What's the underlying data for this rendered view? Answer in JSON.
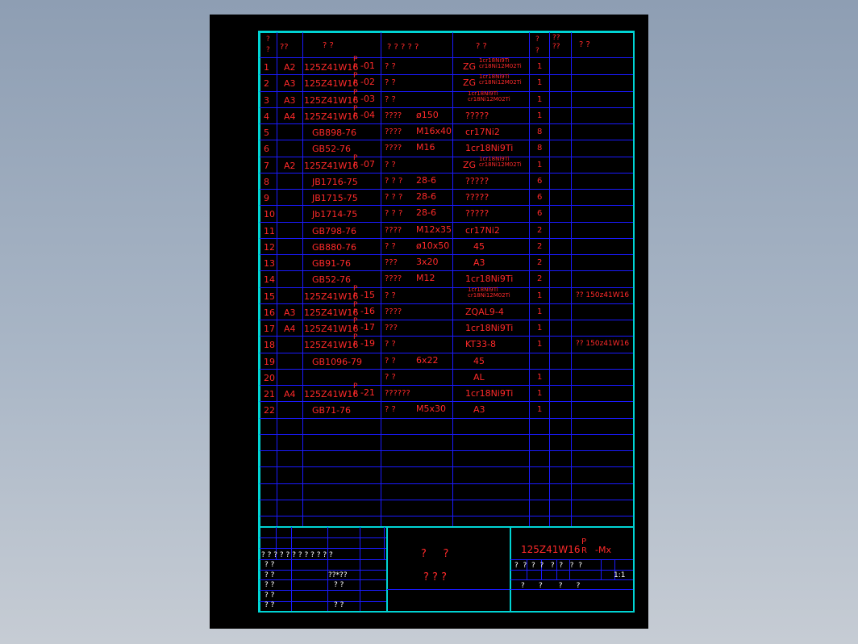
{
  "header": {
    "seq": "? ?",
    "zone": "??",
    "code": "? ?",
    "name": "? ? ? ? ?",
    "material": "? ?",
    "qty": "? ?",
    "weight": "?? ??",
    "remark": "? ?"
  },
  "rows": [
    {
      "n": "1",
      "zone": "A2",
      "code": "125Z41W16",
      "suf": "-01",
      "name": "? ?",
      "spec": "",
      "mat": "ZG",
      "matsub": "1cr18Ni9Ti|cr18Ni12M02Ti",
      "qty": "1",
      "remark": ""
    },
    {
      "n": "2",
      "zone": "A3",
      "code": "125Z41W16",
      "suf": "-02",
      "name": "? ?",
      "spec": "",
      "mat": "ZG",
      "matsub": "1cr18Ni9Ti|cr18Ni12M02Ti",
      "qty": "1",
      "remark": ""
    },
    {
      "n": "3",
      "zone": "A3",
      "code": "125Z41W16",
      "suf": "-03",
      "name": "? ?",
      "spec": "",
      "mat": "",
      "matsub": "1cr18Ni9Ti|cr18Ni12M02Ti",
      "qty": "1",
      "remark": ""
    },
    {
      "n": "4",
      "zone": "A4",
      "code": "125Z41W16",
      "suf": "-04",
      "name": "????",
      "spec": "ø150",
      "mat": "?????",
      "matsub": "",
      "qty": "1",
      "remark": ""
    },
    {
      "n": "5",
      "zone": "",
      "code": "GB898-76",
      "suf": "",
      "name": "????",
      "spec": "M16x40",
      "mat": "cr17Ni2",
      "matsub": "",
      "qty": "8",
      "remark": ""
    },
    {
      "n": "6",
      "zone": "",
      "code": "GB52-76",
      "suf": "",
      "name": "????",
      "spec": "M16",
      "mat": "1cr18Ni9Ti",
      "matsub": "",
      "qty": "8",
      "remark": ""
    },
    {
      "n": "7",
      "zone": "A2",
      "code": "125Z41W16",
      "suf": "-07",
      "name": "? ?",
      "spec": "",
      "mat": "ZG",
      "matsub": "1cr18Ni9Ti|cr18Ni12M02Ti",
      "qty": "1",
      "remark": ""
    },
    {
      "n": "8",
      "zone": "",
      "code": "JB1716-75",
      "suf": "",
      "name": "? ? ?",
      "spec": "28-6",
      "mat": "?????",
      "matsub": "",
      "qty": "6",
      "remark": ""
    },
    {
      "n": "9",
      "zone": "",
      "code": "JB1715-75",
      "suf": "",
      "name": "? ? ?",
      "spec": "28-6",
      "mat": "?????",
      "matsub": "",
      "qty": "6",
      "remark": ""
    },
    {
      "n": "10",
      "zone": "",
      "code": "Jb1714-75",
      "suf": "",
      "name": "? ? ?",
      "spec": "28-6",
      "mat": "?????",
      "matsub": "",
      "qty": "6",
      "remark": ""
    },
    {
      "n": "11",
      "zone": "",
      "code": "GB798-76",
      "suf": "",
      "name": "????",
      "spec": "M12x35",
      "mat": "cr17Ni2",
      "matsub": "",
      "qty": "2",
      "remark": ""
    },
    {
      "n": "12",
      "zone": "",
      "code": "GB880-76",
      "suf": "",
      "name": "? ?",
      "spec": "ø10x50",
      "mat": "45",
      "matsub": "",
      "qty": "2",
      "remark": ""
    },
    {
      "n": "13",
      "zone": "",
      "code": "GB91-76",
      "suf": "",
      "name": "???",
      "spec": "3x20",
      "mat": "A3",
      "matsub": "",
      "qty": "2",
      "remark": ""
    },
    {
      "n": "14",
      "zone": "",
      "code": "GB52-76",
      "suf": "",
      "name": "????",
      "spec": "M12",
      "mat": "1cr18Ni9Ti",
      "matsub": "",
      "qty": "2",
      "remark": ""
    },
    {
      "n": "15",
      "zone": "",
      "code": "125Z41W16",
      "suf": "-15",
      "name": "? ?",
      "spec": "",
      "mat": "",
      "matsub": "1cr18Ni9Ti|cr18Ni12M02Ti",
      "qty": "1",
      "remark": "??  150z41W16"
    },
    {
      "n": "16",
      "zone": "A3",
      "code": "125Z41W16",
      "suf": "-16",
      "name": "????",
      "spec": "",
      "mat": "ZQAL9-4",
      "matsub": "",
      "qty": "1",
      "remark": ""
    },
    {
      "n": "17",
      "zone": "A4",
      "code": "125Z41W16",
      "suf": "-17",
      "name": "???",
      "spec": "",
      "mat": "1cr18Ni9Ti",
      "matsub": "",
      "qty": "1",
      "remark": ""
    },
    {
      "n": "18",
      "zone": "",
      "code": "125Z41W16",
      "suf": "-19",
      "name": "? ?",
      "spec": "",
      "mat": "KT33-8",
      "matsub": "",
      "qty": "1",
      "remark": "??  150z41W16"
    },
    {
      "n": "19",
      "zone": "",
      "code": "GB1096-79",
      "suf": "",
      "name": "? ?",
      "spec": "6x22",
      "mat": "45",
      "matsub": "",
      "qty": "",
      "remark": ""
    },
    {
      "n": "20",
      "zone": "",
      "code": "",
      "suf": "",
      "name": "? ?",
      "spec": "",
      "mat": "AL",
      "matsub": "",
      "qty": "1",
      "remark": ""
    },
    {
      "n": "21",
      "zone": "A4",
      "code": "125Z41W16",
      "suf": "-21",
      "name": "??????",
      "spec": "",
      "mat": "1cr18Ni9Ti",
      "matsub": "",
      "qty": "1",
      "remark": ""
    },
    {
      "n": "22",
      "zone": "",
      "code": "GB71-76",
      "suf": "",
      "name": "? ?",
      "spec": "M5x30",
      "mat": "A3",
      "matsub": "",
      "qty": "1",
      "remark": ""
    }
  ],
  "code_pr": {
    "top": "P",
    "bottom": "R"
  },
  "title_block": {
    "revision_header": "? ? ? ?  ? ?  ? ?  ?  ?  ? ?",
    "left_rows": [
      {
        "a": "? ?",
        "b": ""
      },
      {
        "a": "? ?",
        "b": "??*??"
      },
      {
        "a": "? ?",
        "b": "? ?"
      },
      {
        "a": "? ?",
        "b": ""
      },
      {
        "a": "? ?",
        "b": "? ?"
      }
    ],
    "center_line1": "?     ?",
    "center_line2": "? ? ?",
    "drawing_code": "125Z41W16",
    "drawing_pr_top": "P",
    "drawing_pr_bottom": "R",
    "drawing_suffix": "-Mx",
    "right_header": "?  ?  ?  ?   ?  ?   ?  ?",
    "scale": "1:1",
    "right_bottom": "?      ?       ?      ?"
  },
  "colors": {
    "sheet": "#000000",
    "frame": "#00d4d4",
    "grid": "#1a1aff",
    "text": "#ff2a2a",
    "white_text": "#ffffff"
  }
}
